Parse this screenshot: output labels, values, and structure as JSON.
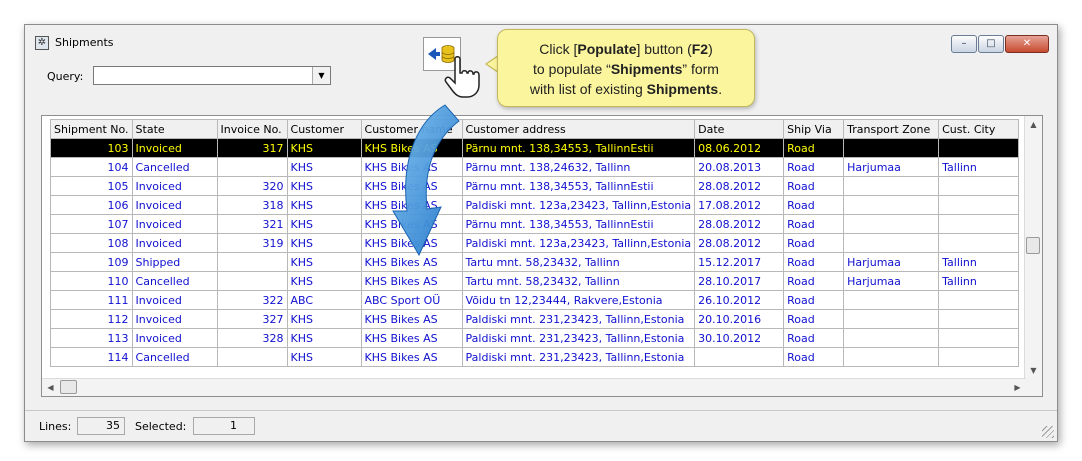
{
  "window": {
    "title": "Shipments",
    "controls": {
      "minimize": "–",
      "maximize": "□",
      "close": "✕"
    }
  },
  "query": {
    "label": "Query:",
    "value": ""
  },
  "callout": {
    "l1_a": "Click [",
    "l1_b": "Populate",
    "l1_c": "] button (",
    "l1_d": "F2",
    "l1_e": ")",
    "l2_a": "to populate “",
    "l2_b": "Shipments",
    "l2_c": "” form",
    "l3_a": "with list of existing ",
    "l3_b": "Shipments",
    "l3_c": "."
  },
  "table": {
    "columns": [
      "Shipment No.",
      "State",
      "Invoice No.",
      "Customer",
      "Customer name",
      "Customer address",
      "Date",
      "Ship Via",
      "Transport Zone",
      "Cust. City"
    ],
    "rows": [
      [
        "103",
        "Invoiced",
        "317",
        "KHS",
        "KHS Bikes AS",
        "Pärnu mnt. 138,34553, TallinnEstii",
        "08.06.2012",
        "Road",
        "",
        ""
      ],
      [
        "104",
        "Cancelled",
        "",
        "KHS",
        "KHS Bikes AS",
        "Pärnu mnt. 138,24632, Tallinn",
        "20.08.2013",
        "Road",
        "Harjumaa",
        "Tallinn"
      ],
      [
        "105",
        "Invoiced",
        "320",
        "KHS",
        "KHS Bikes AS",
        "Pärnu mnt. 138,34553, TallinnEstii",
        "28.08.2012",
        "Road",
        "",
        ""
      ],
      [
        "106",
        "Invoiced",
        "318",
        "KHS",
        "KHS Bikes AS",
        "Paldiski mnt. 123a,23423, Tallinn,Estonia",
        "17.08.2012",
        "Road",
        "",
        ""
      ],
      [
        "107",
        "Invoiced",
        "321",
        "KHS",
        "KHS Bikes AS",
        "Pärnu mnt. 138,34553, TallinnEstii",
        "28.08.2012",
        "Road",
        "",
        ""
      ],
      [
        "108",
        "Invoiced",
        "319",
        "KHS",
        "KHS Bikes AS",
        "Paldiski mnt. 123a,23423, Tallinn,Estonia",
        "28.08.2012",
        "Road",
        "",
        ""
      ],
      [
        "109",
        "Shipped",
        "",
        "KHS",
        "KHS Bikes AS",
        "Tartu mnt. 58,23432, Tallinn",
        "15.12.2017",
        "Road",
        "Harjumaa",
        "Tallinn"
      ],
      [
        "110",
        "Cancelled",
        "",
        "KHS",
        "KHS Bikes AS",
        "Tartu mnt. 58,23432, Tallinn",
        "28.10.2017",
        "Road",
        "Harjumaa",
        "Tallinn"
      ],
      [
        "111",
        "Invoiced",
        "322",
        "ABC",
        "ABC Sport OÜ",
        "Võidu tn 12,23444, Rakvere,Estonia",
        "26.10.2012",
        "Road",
        "",
        ""
      ],
      [
        "112",
        "Invoiced",
        "327",
        "KHS",
        "KHS Bikes AS",
        "Paldiski mnt. 231,23423, Tallinn,Estonia",
        "20.10.2016",
        "Road",
        "",
        ""
      ],
      [
        "113",
        "Invoiced",
        "328",
        "KHS",
        "KHS Bikes AS",
        "Paldiski mnt. 231,23423, Tallinn,Estonia",
        "30.10.2012",
        "Road",
        "",
        ""
      ],
      [
        "114",
        "Cancelled",
        "",
        "KHS",
        "KHS Bikes AS",
        "Paldiski mnt. 231,23423, Tallinn,Estonia",
        "",
        "Road",
        "",
        ""
      ]
    ],
    "selected_row": 0
  },
  "status": {
    "lines_label": "Lines:",
    "lines_value": "35",
    "selected_label": "Selected:",
    "selected_value": "1"
  },
  "colors": {
    "row_text": "#1010d0",
    "selected_bg": "#000000",
    "selected_text": "#ffff00",
    "callout_bg": "#fbf59e",
    "arrow": "#3a8fd8"
  },
  "icons": {
    "window": "gear-icon",
    "populate": "populate-database-icon",
    "cursor": "hand-pointer-icon"
  }
}
